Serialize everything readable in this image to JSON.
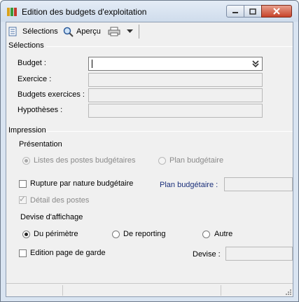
{
  "window": {
    "title": "Edition des budgets d'exploitation"
  },
  "toolbar": {
    "selections_label": "Sélections",
    "preview_label": "Aperçu"
  },
  "selections": {
    "section_title": "Sélections",
    "budget_label": "Budget :",
    "budget_value": "",
    "exercice_label": "Exercice :",
    "budgets_exercices_label": "Budgets exercices :",
    "hypotheses_label": "Hypothèses :"
  },
  "impression": {
    "section_title": "Impression",
    "presentation_label": "Présentation",
    "radio_listes": "Listes des postes budgétaires",
    "radio_plan": "Plan budgétaire",
    "rupture_label": "Rupture par nature budgétaire",
    "plan_budgetaire_label": "Plan budgétaire :",
    "detail_label": "Détail des postes",
    "devise_affichage_label": "Devise d'affichage",
    "radio_perimetre": "Du périmètre",
    "radio_reporting": "De reporting",
    "radio_autre": "Autre",
    "edition_garde_label": "Edition page de garde",
    "devise_label": "Devise :"
  },
  "state": {
    "presentation_selected": "listes",
    "devise_selected": "perimetre",
    "rupture_checked": false,
    "detail_checked": true,
    "edition_garde_checked": false
  },
  "colors": {
    "accent_label": "#1a2f7a",
    "window_frame": "#d9e4f1",
    "close_button": "#c7432a"
  }
}
